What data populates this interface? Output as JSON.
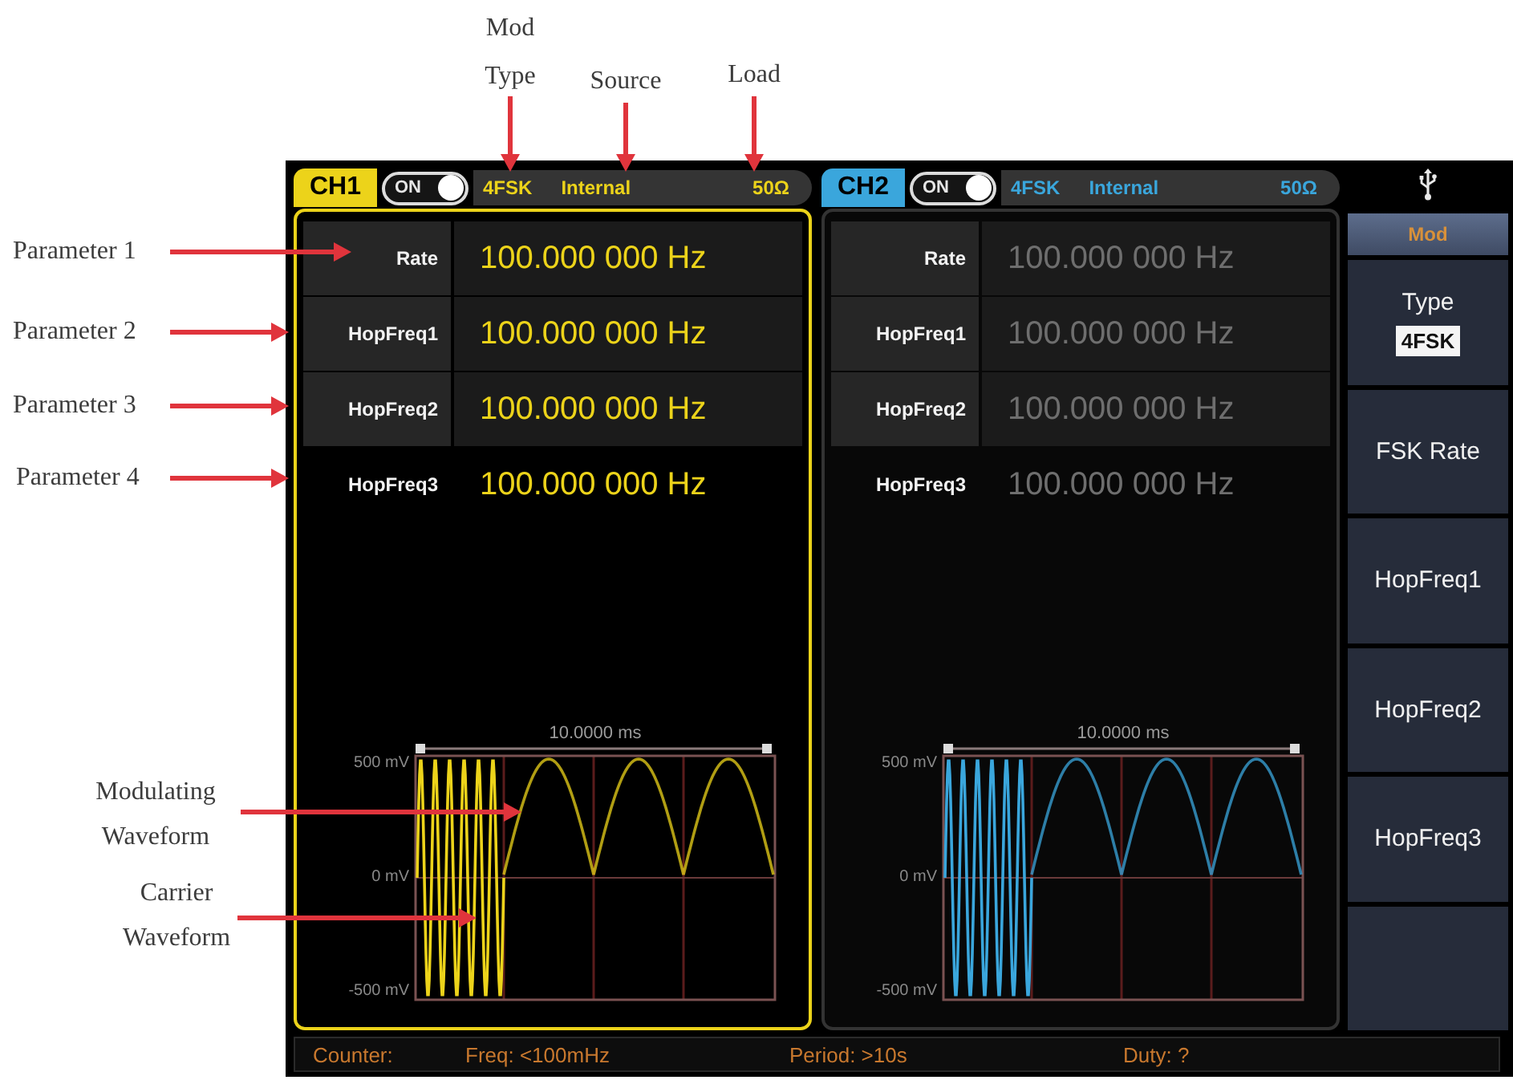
{
  "callouts_top": [
    "Mod Type",
    "Source",
    "Load"
  ],
  "callouts_parameters": [
    "Parameter 1",
    "Parameter 2",
    "Parameter 3",
    "Parameter 4"
  ],
  "callouts_waveforms": [
    "Modulating Waveform",
    "Carrier Waveform"
  ],
  "channels": [
    {
      "name": "CH1",
      "color": "#ecd31a",
      "selected": true,
      "switch": {
        "label": "ON",
        "on": true
      },
      "mod_type": "4FSK",
      "source": "Internal",
      "load": "50Ω",
      "parameters": [
        {
          "label": "Rate",
          "value": "100.000 000 Hz"
        },
        {
          "label": "HopFreq1",
          "value": "100.000 000 Hz"
        },
        {
          "label": "HopFreq2",
          "value": "100.000 000 Hz"
        },
        {
          "label": "HopFreq3",
          "value": "100.000 000 Hz"
        }
      ],
      "plot": {
        "time_span": "10.0000 ms",
        "y_labels": [
          "500 mV",
          "0 mV",
          "-500 mV"
        ]
      }
    },
    {
      "name": "CH2",
      "color": "#3aa6dc",
      "selected": false,
      "switch": {
        "label": "ON",
        "on": true
      },
      "mod_type": "4FSK",
      "source": "Internal",
      "load": "50Ω",
      "parameters": [
        {
          "label": "Rate",
          "value": "100.000 000 Hz"
        },
        {
          "label": "HopFreq1",
          "value": "100.000 000 Hz"
        },
        {
          "label": "HopFreq2",
          "value": "100.000 000 Hz"
        },
        {
          "label": "HopFreq3",
          "value": "100.000 000 Hz"
        }
      ],
      "plot": {
        "time_span": "10.0000 ms",
        "y_labels": [
          "500 mV",
          "0 mV",
          "-500 mV"
        ]
      }
    }
  ],
  "menu": {
    "title": "Mod",
    "items": [
      {
        "label": "Type",
        "value": "4FSK"
      },
      {
        "label": "FSK Rate"
      },
      {
        "label": "HopFreq1"
      },
      {
        "label": "HopFreq2"
      },
      {
        "label": "HopFreq3"
      }
    ]
  },
  "status_bar": [
    "Counter:",
    "Freq: <100mHz",
    "Period: >10s",
    "Duty: ?"
  ]
}
